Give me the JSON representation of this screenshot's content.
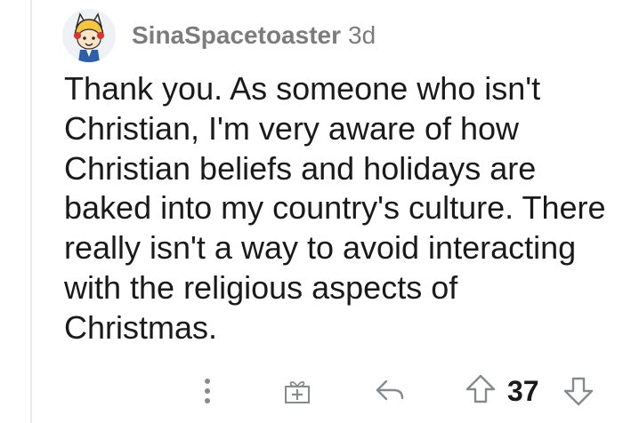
{
  "comment": {
    "author": "SinaSpacetoaster",
    "age": "3d",
    "body": "Thank you. As someone who isn't Christian, I'm very aware of how Christian beliefs and holidays are baked into my country's culture. There really isn't a way to avoid interacting with the religious aspects of Christmas."
  },
  "actions": {
    "more_icon": "more-vertical-icon",
    "award_icon": "gift-icon",
    "reply_icon": "reply-icon",
    "upvote_icon": "arrow-up-icon",
    "vote_count": "37",
    "downvote_icon": "arrow-down-icon"
  },
  "colors": {
    "text": "#1a1a1b",
    "meta": "#7c7c7c",
    "icon": "#878a8c",
    "thread_line": "#ebebeb"
  }
}
